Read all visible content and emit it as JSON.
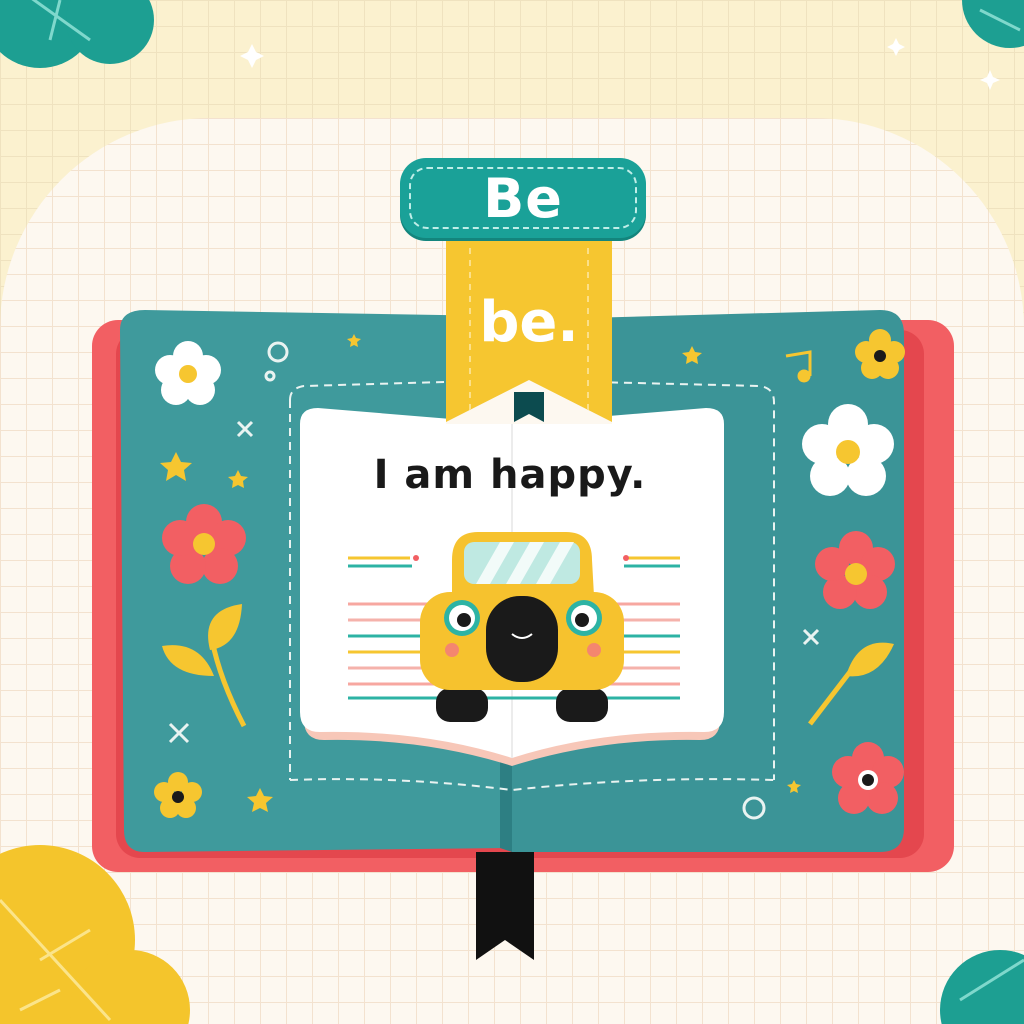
{
  "bookmark_tag": {
    "label": "Be"
  },
  "ribbon": {
    "label": "be."
  },
  "page": {
    "sentence": "I am happy."
  },
  "colors": {
    "teal": "#1aa198",
    "book_cover": "#3f9a9c",
    "book_back": "#f25f63",
    "ribbon_yellow": "#f6c630",
    "car_yellow": "#f6c22e",
    "paper": "#fdf8f0"
  },
  "icons": [
    "flower-icon",
    "star-icon",
    "leaf-icon",
    "music-note-icon",
    "sparkle-icon",
    "circle-icon",
    "cross-icon",
    "car-icon"
  ]
}
